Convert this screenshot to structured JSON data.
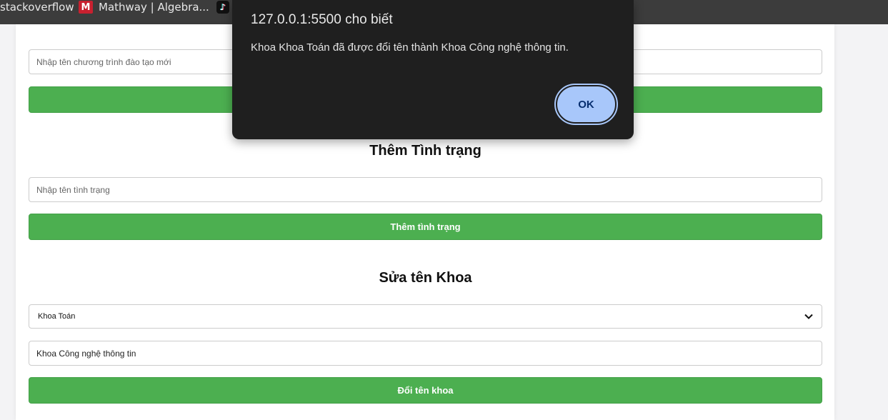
{
  "bookmarks": {
    "items": [
      {
        "label": "stackoverflow"
      },
      {
        "label": "Mathway | Algebra..."
      },
      {
        "label": ""
      }
    ]
  },
  "form": {
    "program_input": {
      "placeholder": "Nhập tên chương trình đào tạo mới",
      "value": ""
    },
    "program_button": {
      "label": ""
    },
    "status_section": {
      "title": "Thêm Tình trạng",
      "input": {
        "placeholder": "Nhập tên tình trạng",
        "value": ""
      },
      "button": {
        "label": "Thêm tình trạng"
      }
    },
    "rename_section": {
      "title": "Sửa tên Khoa",
      "select": {
        "selected": "Khoa Toán"
      },
      "input": {
        "value": "Khoa Công nghệ thông tin"
      },
      "button": {
        "label": "Đổi tên khoa"
      }
    }
  },
  "dialog": {
    "title": "127.0.0.1:5500 cho biết",
    "message": "Khoa Khoa Toán đã được đổi tên thành Khoa Công nghệ thông tin.",
    "ok_label": "OK"
  },
  "colors": {
    "primary_button": "#4caf50",
    "dialog_bg": "#1f1f1f",
    "ok_button": "#a8c7fa"
  }
}
